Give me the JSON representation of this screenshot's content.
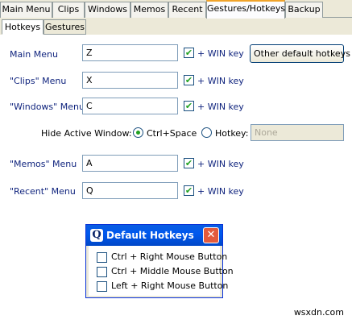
{
  "top_tabs": [
    "Main Menu",
    "Clips",
    "Windows",
    "Memos",
    "Recent",
    "Gestures/Hotkeys",
    "Backup"
  ],
  "active_top_tab": "Gestures/Hotkeys",
  "sub_tabs": [
    "Hotkeys",
    "Gestures"
  ],
  "active_sub_tab": "Hotkeys",
  "hotkeys": [
    {
      "label": "Main Menu",
      "key": "Z",
      "win_checked": true,
      "win_label": "+ WIN key"
    },
    {
      "label": "\"Clips\" Menu",
      "key": "X",
      "win_checked": true,
      "win_label": "+ WIN key"
    },
    {
      "label": "\"Windows\" Menu",
      "key": "C",
      "win_checked": true,
      "win_label": "+ WIN key"
    },
    {
      "label": "\"Memos\" Menu",
      "key": "A",
      "win_checked": true,
      "win_label": "+ WIN key"
    },
    {
      "label": "\"Recent\" Menu",
      "key": "Q",
      "win_checked": true,
      "win_label": "+ WIN key"
    }
  ],
  "other_defaults_button": "Other default hotkeys",
  "hide_window": {
    "label": "Hide Active Window:",
    "option_ctrl_space": "Ctrl+Space",
    "option_hotkey": "Hotkey:",
    "hotkey_value": "None",
    "selected": "ctrl_space"
  },
  "dialog": {
    "title": "Default Hotkeys",
    "icon_letter": "Q",
    "items": [
      {
        "label": "Ctrl + Right Mouse Button",
        "checked": false
      },
      {
        "label": "Ctrl + Middle Mouse Button",
        "checked": false
      },
      {
        "label": "Left + Right Mouse Button",
        "checked": false
      }
    ]
  },
  "watermark": "wsxdn.com",
  "colors": {
    "accent": "#f1a42b",
    "label": "#10247e",
    "titlebar": "#0058ee"
  }
}
